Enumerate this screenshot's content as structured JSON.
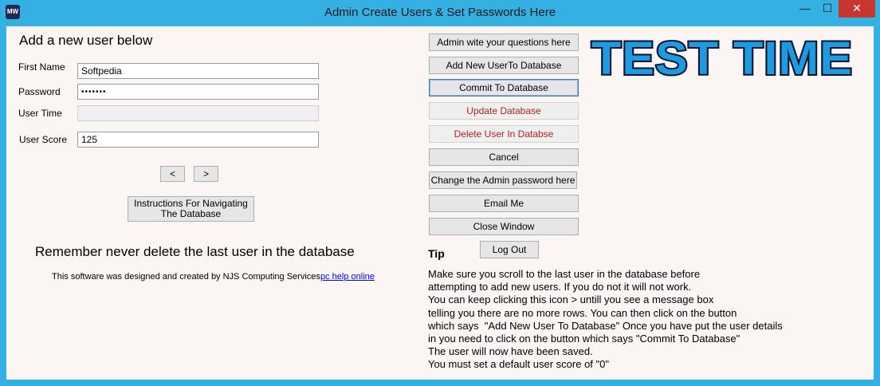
{
  "window": {
    "title": "Admin Create Users & Set Passwords Here",
    "app_icon_text": "MW",
    "min_glyph": "—",
    "max_glyph": "☐",
    "close_glyph": "✕"
  },
  "form": {
    "heading": "Add a new user below",
    "first_name_label": "First Name",
    "first_name_value": "Softpedia",
    "password_label": "Password",
    "password_value": "•••••••",
    "user_time_label": "User Time",
    "user_time_value": "",
    "user_score_label": "User Score",
    "user_score_value": "125",
    "prev_label": "<",
    "next_label": ">",
    "instructions_line1": "Instructions For Navigating",
    "instructions_line2": "The Database"
  },
  "warning": "Remember never delete the last user in the database",
  "credit": "This software was designed and created by NJS Computing Services",
  "link": "pc help online",
  "buttons": {
    "questions": "Admin wite your questions here",
    "add_user": "Add New UserTo Database",
    "commit": "Commit To Database",
    "update": "Update Database",
    "delete": "Delete User In Databse",
    "cancel": "Cancel",
    "change_password": "Change the Admin password here",
    "email": "Email Me",
    "close": "Close Window",
    "logout": "Log Out"
  },
  "logo_text": "TEST TIME",
  "tip": {
    "title": "Tip",
    "lines": [
      "Make sure you scroll to the last user in the database before",
      "attempting to add new users. If you do not it will not work.",
      "You can keep clicking this icon > untill you see a message box",
      "telling you there are no more rows. You can then click on the button",
      "which says  \"Add New User To Database\" Once you have put the user details",
      "in you need to click on the button which says \"Commit To Database\"",
      "The user will now have been saved.",
      "You must set a default user score of \"0\""
    ]
  },
  "colors": {
    "frame": "#35b0e3",
    "client": "#fbf5f4",
    "close_button": "#c7372f",
    "logo_fill": "#1e9ae0",
    "logo_outline": "#0a1430",
    "red_text": "#b22222",
    "link": "#0000ff"
  }
}
